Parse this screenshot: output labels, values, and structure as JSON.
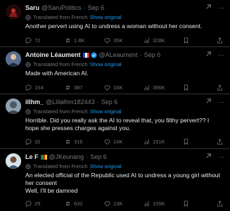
{
  "tweets": [
    {
      "name": "Saru",
      "handle": "@SaruPolitics",
      "date": "Sep 6",
      "translated": "Translated from French",
      "show_original": "Show original",
      "text": "Another pervert using AI to undress a woman without her consent.",
      "replies": "72",
      "reposts": "1.8K",
      "likes": "35K",
      "views": "328K"
    },
    {
      "name": "Antoine Léaument",
      "handle": "@ALeaument",
      "date": "Sep 6",
      "translated": "Translated from French",
      "show_original": "Show original",
      "text": "Made with American AI.",
      "replies": "154",
      "reposts": "387",
      "likes": "16K",
      "views": "396K"
    },
    {
      "name": "illhm_",
      "handle": "@Llilalhm182443",
      "date": "Sep 6",
      "translated": "Translated from French",
      "show_original": "Show original",
      "text": "Horrible. Did you really ask the AI to reveal that, you filthy pervert?? I hope she presses charges against you.",
      "replies": "32",
      "reposts": "316",
      "likes": "14K",
      "views": "151K"
    },
    {
      "name": "Le F",
      "handle": "@JKeunang",
      "date": "Sep 6",
      "translated": "Translated from French",
      "show_original": "Show original",
      "text": "An elected official of the Republic used AI to undress a young girl without her consent",
      "text2": "Well, I'll be damned",
      "replies": "29",
      "reposts": "632",
      "likes": "13K",
      "views": "155K"
    }
  ],
  "colors": {
    "accent": "#1d9bf0",
    "muted": "#71767b",
    "bg": "#000000",
    "text": "#e7e9ea"
  }
}
